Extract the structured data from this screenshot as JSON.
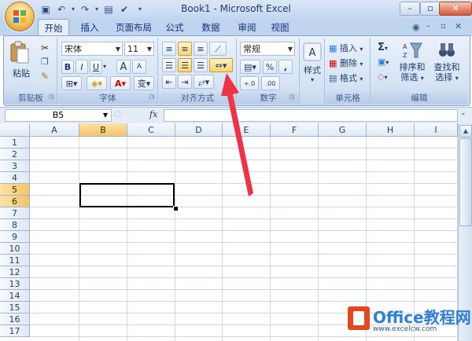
{
  "window": {
    "title": "Book1 - Microsoft Excel"
  },
  "tabs": [
    "开始",
    "插入",
    "页面布局",
    "公式",
    "数据",
    "审阅",
    "视图"
  ],
  "active_tab": "开始",
  "ribbon": {
    "clipboard": {
      "paste_label": "粘贴",
      "group_label": "剪贴板"
    },
    "font": {
      "font_name": "宋体",
      "font_size": "11",
      "bold": "B",
      "italic": "I",
      "underline": "U",
      "grow": "A",
      "shrink": "A",
      "color_letter": "A",
      "wen": "变",
      "group_label": "字体"
    },
    "alignment": {
      "group_label": "对齐方式"
    },
    "number": {
      "format": "常规",
      "percent": "%",
      "comma": ",",
      "group_label": "数字"
    },
    "styles": {
      "label": "样式"
    },
    "cells": {
      "insert": "插入",
      "delete": "删除",
      "format": "格式",
      "group_label": "单元格"
    },
    "editing": {
      "sort_filter": "排序和\n筛选",
      "find_select": "查找和\n选择",
      "sort_l1": "排序和",
      "sort_l2": "筛选",
      "find_l1": "查找和",
      "find_l2": "选择",
      "group_label": "编辑"
    }
  },
  "name_box": "B5",
  "fx": "fx",
  "columns": [
    "A",
    "B",
    "C",
    "D",
    "E",
    "F",
    "G",
    "H",
    "I"
  ],
  "rows": [
    "1",
    "2",
    "3",
    "4",
    "5",
    "6",
    "7",
    "8",
    "9",
    "10",
    "11",
    "12",
    "13",
    "14",
    "15",
    "16",
    "17"
  ],
  "selected_cell": "B5",
  "watermark": {
    "text": "Office教程网",
    "url": "www.office26.com",
    "url2": "www.excelcw.com"
  },
  "colors": {
    "accent": "#f5c267",
    "arrow": "#ee3344"
  }
}
